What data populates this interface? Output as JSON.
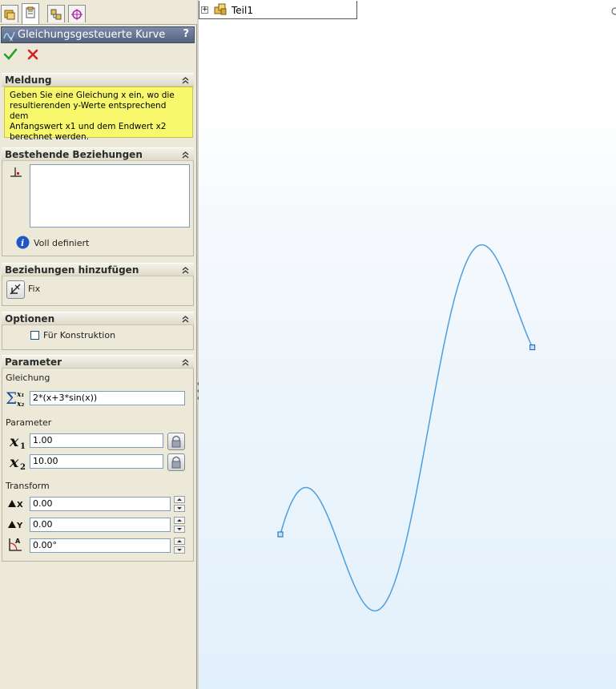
{
  "feature": {
    "title": "Gleichungsgesteuerte Kurve",
    "help": "?"
  },
  "groups": {
    "meldung": {
      "title": "Meldung",
      "lines": [
        "Geben Sie eine Gleichung x ein, wo die",
        "resultierenden y-Werte entsprechend dem",
        "Anfangswert x1 und dem Endwert x2",
        "berechnet werden."
      ]
    },
    "existing": {
      "title": "Bestehende Beziehungen",
      "status": "Voll definiert"
    },
    "add": {
      "title": "Beziehungen hinzufügen",
      "fix_label": "Fix"
    },
    "options": {
      "title": "Optionen",
      "construction_label": "Für Konstruktion",
      "construction_checked": false
    },
    "parameter": {
      "title": "Parameter",
      "equation_label": "Gleichung",
      "equation_value": "2*(x+3*sin(x))",
      "parameter_label": "Parameter",
      "x1_value": "1.00",
      "x2_value": "10.00",
      "transform_label": "Transform",
      "dx_value": "0.00",
      "dy_value": "0.00",
      "angle_value": "0.00°"
    }
  },
  "tree": {
    "root": "Teil1"
  },
  "colors": {
    "curve": "#4b9fe0",
    "endpoint": "#1d5fb4",
    "message_bg": "#f8f86d",
    "title_bg": "#5f6c88"
  },
  "curve": {
    "equation": "2*(x+3*sin(x))",
    "x_start": 1.0,
    "x_end": 10.0
  }
}
